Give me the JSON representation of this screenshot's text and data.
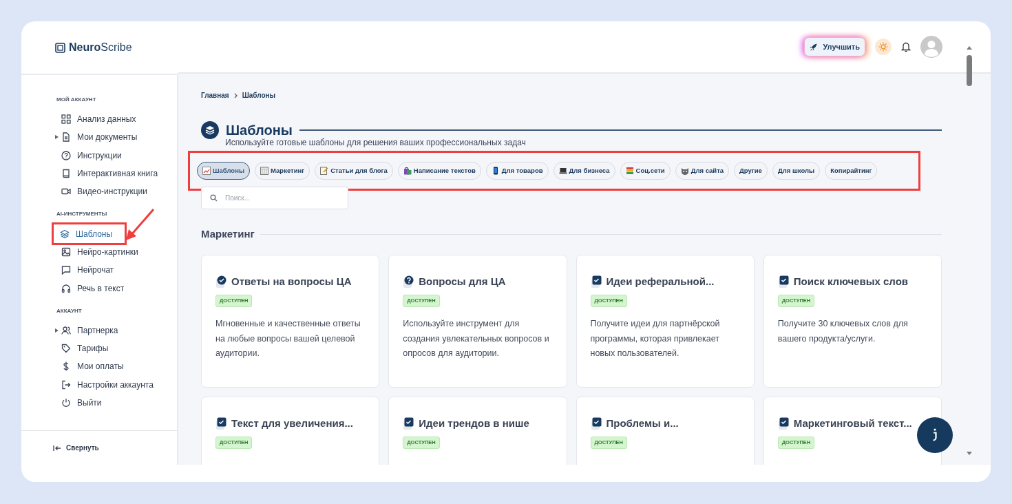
{
  "logo": {
    "bold": "Neuro",
    "light": "Scribe"
  },
  "header": {
    "upgrade": "Улучшить"
  },
  "sidebar": {
    "sections": [
      {
        "title": "МОЙ АККАУНТ",
        "items": [
          {
            "label": "Анализ данных",
            "selected": false,
            "highlighted": false
          },
          {
            "label": "Мои документы",
            "selected": false,
            "highlighted": false,
            "expanded": false
          },
          {
            "label": "Инструкции",
            "selected": false,
            "highlighted": false
          },
          {
            "label": "Интерактивная книга",
            "selected": false,
            "highlighted": false
          },
          {
            "label": "Видео-инструкции",
            "selected": false,
            "highlighted": false
          }
        ]
      },
      {
        "title": "AI-ИНСТРУМЕНТЫ",
        "items": [
          {
            "label": "Шаблоны",
            "selected": true,
            "highlighted": true
          },
          {
            "label": "Нейро-картинки",
            "selected": false,
            "highlighted": false
          },
          {
            "label": "Нейрочат",
            "selected": false,
            "highlighted": false
          },
          {
            "label": "Речь в текст",
            "selected": false,
            "highlighted": false
          }
        ]
      },
      {
        "title": "АККАУНТ",
        "items": [
          {
            "label": "Партнерка",
            "selected": false,
            "highlighted": false,
            "expanded": false
          },
          {
            "label": "Тарифы",
            "selected": false,
            "highlighted": false
          },
          {
            "label": "Мои оплаты",
            "selected": false,
            "highlighted": false
          },
          {
            "label": "Настройки аккаунта",
            "selected": false,
            "highlighted": false
          },
          {
            "label": "Выйти",
            "selected": false,
            "highlighted": false
          }
        ]
      }
    ],
    "collapse": "Свернуть"
  },
  "breadcrumb": [
    "Главная",
    "Шаблоны"
  ],
  "page": {
    "title": "Шаблоны",
    "subtitle": "Используйте готовые шаблоны для решения ваших профессиональных задач"
  },
  "tabs_highlighted": true,
  "tabs": [
    {
      "label": "Шаблоны",
      "selected": true
    },
    {
      "label": "Маркетинг",
      "selected": false
    },
    {
      "label": "Статьи для блога",
      "selected": false
    },
    {
      "label": "Написание текстов",
      "selected": false
    },
    {
      "label": "Для товаров",
      "selected": false
    },
    {
      "label": "Для бизнеса",
      "selected": false
    },
    {
      "label": "Соц.сети",
      "selected": false
    },
    {
      "label": "Для сайта",
      "selected": false
    },
    {
      "label": "Другие",
      "selected": false
    },
    {
      "label": "Для школы",
      "selected": false
    },
    {
      "label": "Копирайтинг",
      "selected": false
    }
  ],
  "search": {
    "placeholder": "Поиск..."
  },
  "section": {
    "title": "Маркетинг"
  },
  "cards": [
    {
      "kind": "check-circle",
      "title": "Ответы на вопросы ЦА",
      "badge": "ДОСТУПЕН",
      "description": "Мгновенные и качественные ответы на любые вопросы вашей целевой аудитории."
    },
    {
      "kind": "question-circle",
      "title": "Вопросы для ЦА",
      "badge": "ДОСТУПЕН",
      "description": "Используйте инструмент для создания увлекательных вопросов и опросов для аудитории."
    },
    {
      "kind": "checkbox",
      "title": "Идеи реферальной...",
      "badge": "ДОСТУПЕН",
      "description": "Получите идеи для партнёрской программы, которая привлекает новых пользователей."
    },
    {
      "kind": "checkbox",
      "title": "Поиск ключевых слов",
      "badge": "ДОСТУПЕН",
      "description": "Получите 30 ключевых слов для вашего продукта/услуги."
    },
    {
      "kind": "checkbox",
      "title": "Текст для увеличения...",
      "badge": "ДОСТУПЕН"
    },
    {
      "kind": "checkbox",
      "title": "Идеи трендов в нише",
      "badge": "ДОСТУПЕН"
    },
    {
      "kind": "checkbox",
      "title": "Проблемы и...",
      "badge": "ДОСТУПЕН"
    },
    {
      "kind": "checkbox",
      "title": "Маркетинговый текст...",
      "badge": "ДОСТУПЕН"
    }
  ]
}
